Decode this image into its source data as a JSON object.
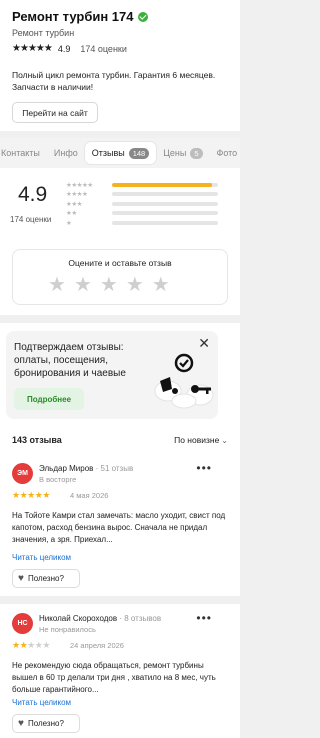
{
  "header": {
    "title": "Ремонт турбин 174",
    "category": "Ремонт турбин",
    "rating": "4.9",
    "rating_count": "174 оценки",
    "description": "Полный цикл ремонта турбин. Гарантия 6 месяцев. Запчасти в наличии!",
    "site_button": "Перейти на сайт"
  },
  "tabs": [
    {
      "label": "Контакты",
      "badge": null
    },
    {
      "label": "Инфо",
      "badge": null
    },
    {
      "label": "Отзывы",
      "badge": "148",
      "active": true
    },
    {
      "label": "Цены",
      "badge": "5"
    },
    {
      "label": "Фото",
      "badge": null
    }
  ],
  "summary": {
    "rating": "4.9",
    "count": "174 оценки",
    "distribution": [
      {
        "stars": 5,
        "fraction": 0.94
      },
      {
        "stars": 4,
        "fraction": 0.0
      },
      {
        "stars": 3,
        "fraction": 0.0
      },
      {
        "stars": 2,
        "fraction": 0.0
      },
      {
        "stars": 1,
        "fraction": 0.0
      }
    ],
    "leave_title": "Оцените и оставьте отзыв"
  },
  "promo": {
    "text": "Подтверждаем отзывы: оплаты, посещения, бронирования и чаевые",
    "button": "Подробнее"
  },
  "reviews_section": {
    "count_label": "143 отзыва",
    "sort_label": "По новизне"
  },
  "reviews": [
    {
      "initials": "ЭМ",
      "author": "Эльдар Миров",
      "meta": " · 51 отзыв",
      "sub": "В восторге",
      "stars": 5,
      "date": "4 мая 2026",
      "text": "На Тойоте Камри стал замечать: масло уходит, свист под капотом, расход бензина вырос. Сначала не придал значения, а зря. Приехал...",
      "read_more": "Читать целиком",
      "useful": "Полезно?"
    },
    {
      "initials": "НС",
      "author": "Николай Скороходов",
      "meta": " · 8 отзывов",
      "sub": "Не понравилось",
      "stars": 2,
      "date": "24 апреля 2026",
      "text": "Не рекомендую сюда обращаться, ремонт турбины вышел в 60 тр делали три дня , хватило на 8 мес, чуть больше гарантийного...",
      "read_more": "Читать целиком",
      "useful": "Полезно?"
    }
  ],
  "colors": {
    "accent_star": "#f6b21c",
    "avatar": "#e43b3b",
    "link": "#1a6fd6",
    "verified": "#3bb13b"
  }
}
